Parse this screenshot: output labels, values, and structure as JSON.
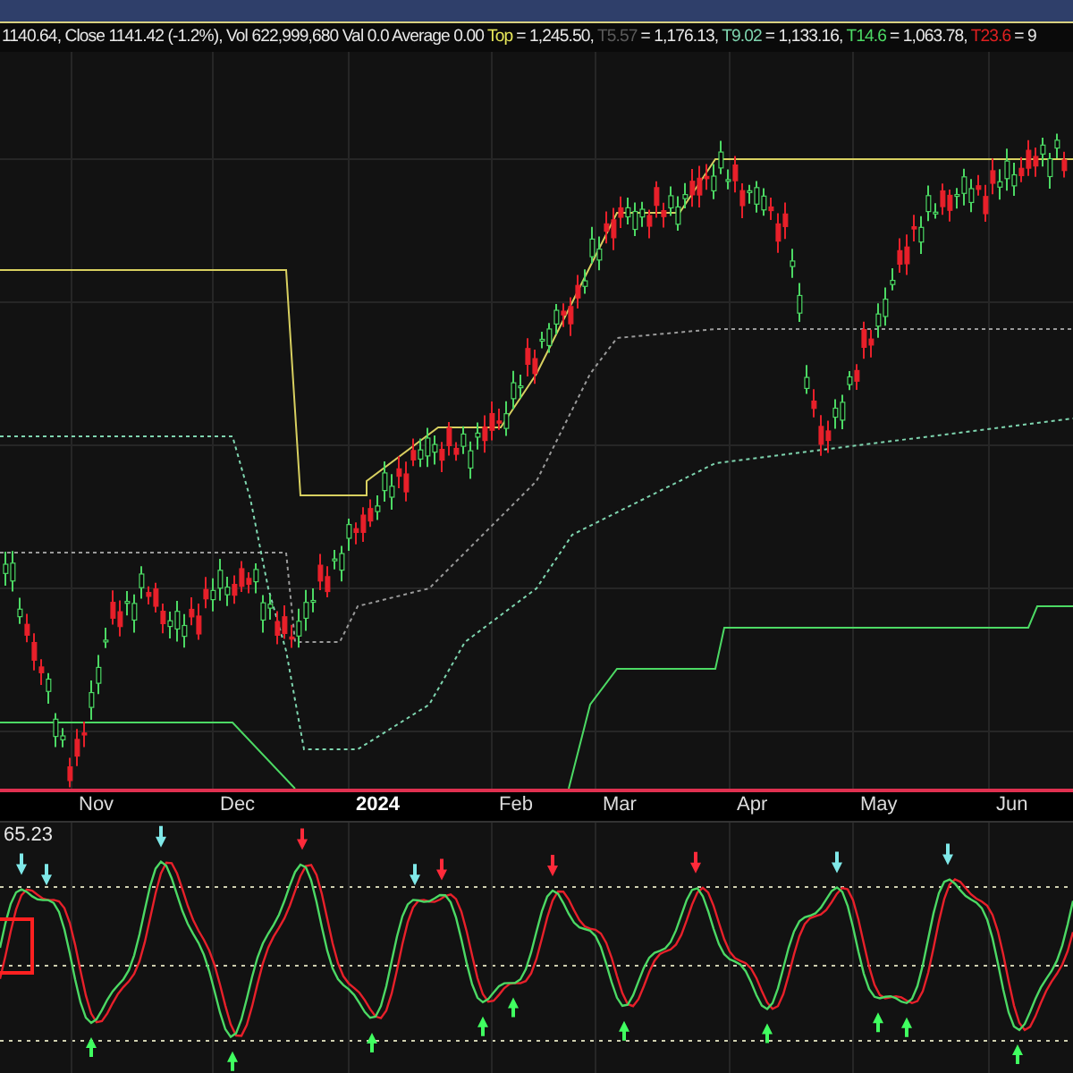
{
  "legend": {
    "prefix": "1140.64, Close 1141.42 (-1.2%), Vol 622,999,680 Val 0.0 Average 0.00",
    "levels": [
      {
        "label": "Top",
        "color": "#e8e85a",
        "value": "= 1,245.50,"
      },
      {
        "label": "T5.57",
        "color": "#5a5a5a",
        "value": "= 1,176.13,"
      },
      {
        "label": "T9.02",
        "color": "#7fd6b0",
        "value": "= 1,133.16,"
      },
      {
        "label": "T14.6",
        "color": "#4cd964",
        "value": "= 1,063.78,"
      },
      {
        "label": "T23.6",
        "color": "#e02020",
        "value": "= 9"
      }
    ]
  },
  "x_axis": [
    {
      "label": "Nov",
      "kind": "month"
    },
    {
      "label": "Dec",
      "kind": "month"
    },
    {
      "label": "2024",
      "kind": "year"
    },
    {
      "label": "Feb",
      "kind": "month"
    },
    {
      "label": "Mar",
      "kind": "month"
    },
    {
      "label": "Apr",
      "kind": "month"
    },
    {
      "label": "May",
      "kind": "month"
    },
    {
      "label": "Jun",
      "kind": "month"
    }
  ],
  "oscillator": {
    "reading": "65.23"
  }
}
